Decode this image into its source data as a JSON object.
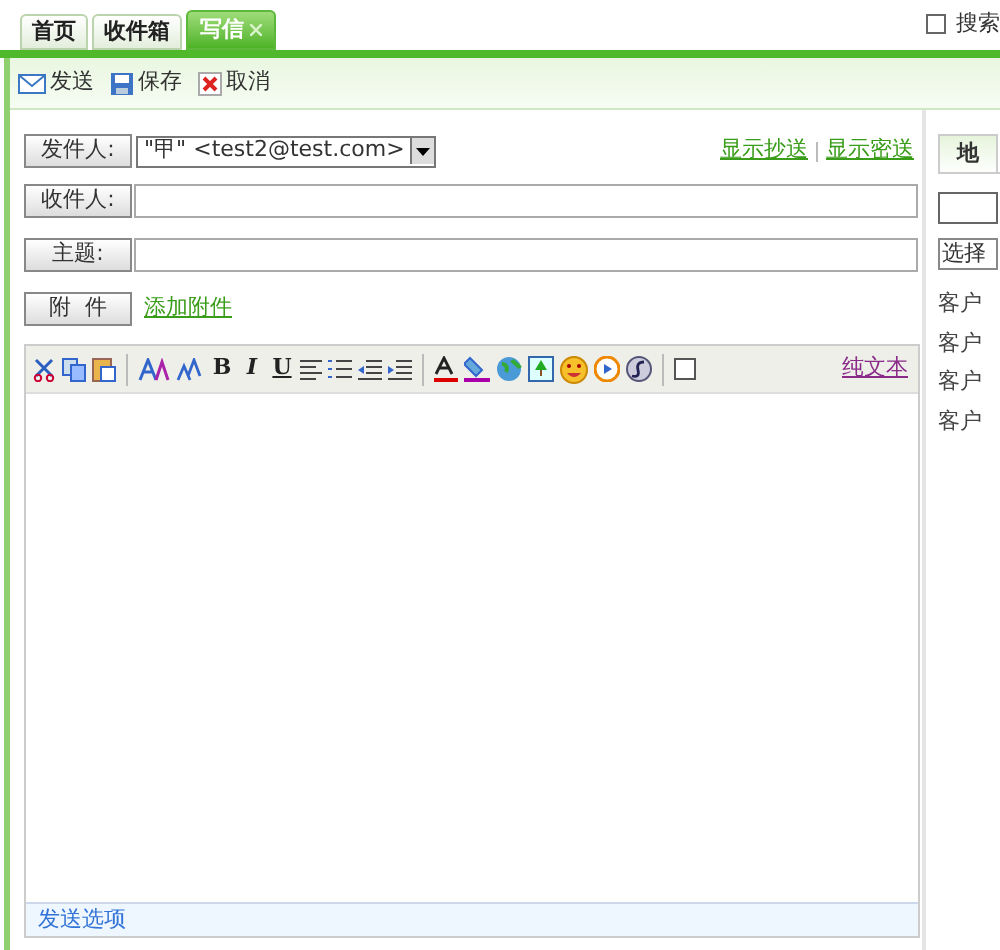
{
  "tabs": [
    {
      "label": "首页",
      "selected": false,
      "closable": false
    },
    {
      "label": "收件箱",
      "selected": false,
      "closable": false
    },
    {
      "label": "写信",
      "selected": true,
      "closable": true
    }
  ],
  "search_toggle": {
    "label": "搜索",
    "checked": false
  },
  "toolbar": [
    {
      "kind": "send",
      "label": "发送"
    },
    {
      "kind": "save",
      "label": "保存"
    },
    {
      "kind": "cancel",
      "label": "取消"
    }
  ],
  "from": {
    "label": "发件人:",
    "value": "\"甲\" <test2@test.com>"
  },
  "links": [
    "显示抄送",
    "显示密送"
  ],
  "to": {
    "label": "收件人:"
  },
  "subject": {
    "label": "主题:"
  },
  "attachment": {
    "label": "附  件",
    "link": "添加附件"
  },
  "editor": {
    "format_buttons": [
      "B",
      "I",
      "U"
    ],
    "html_checkbox": {
      "checked": false
    },
    "plain_text_link": "纯文本"
  },
  "send_options": "发送选项",
  "side_panel": {
    "tab": "地",
    "select": "选择",
    "items": [
      "客户",
      "客户",
      "客户",
      "客户"
    ]
  }
}
